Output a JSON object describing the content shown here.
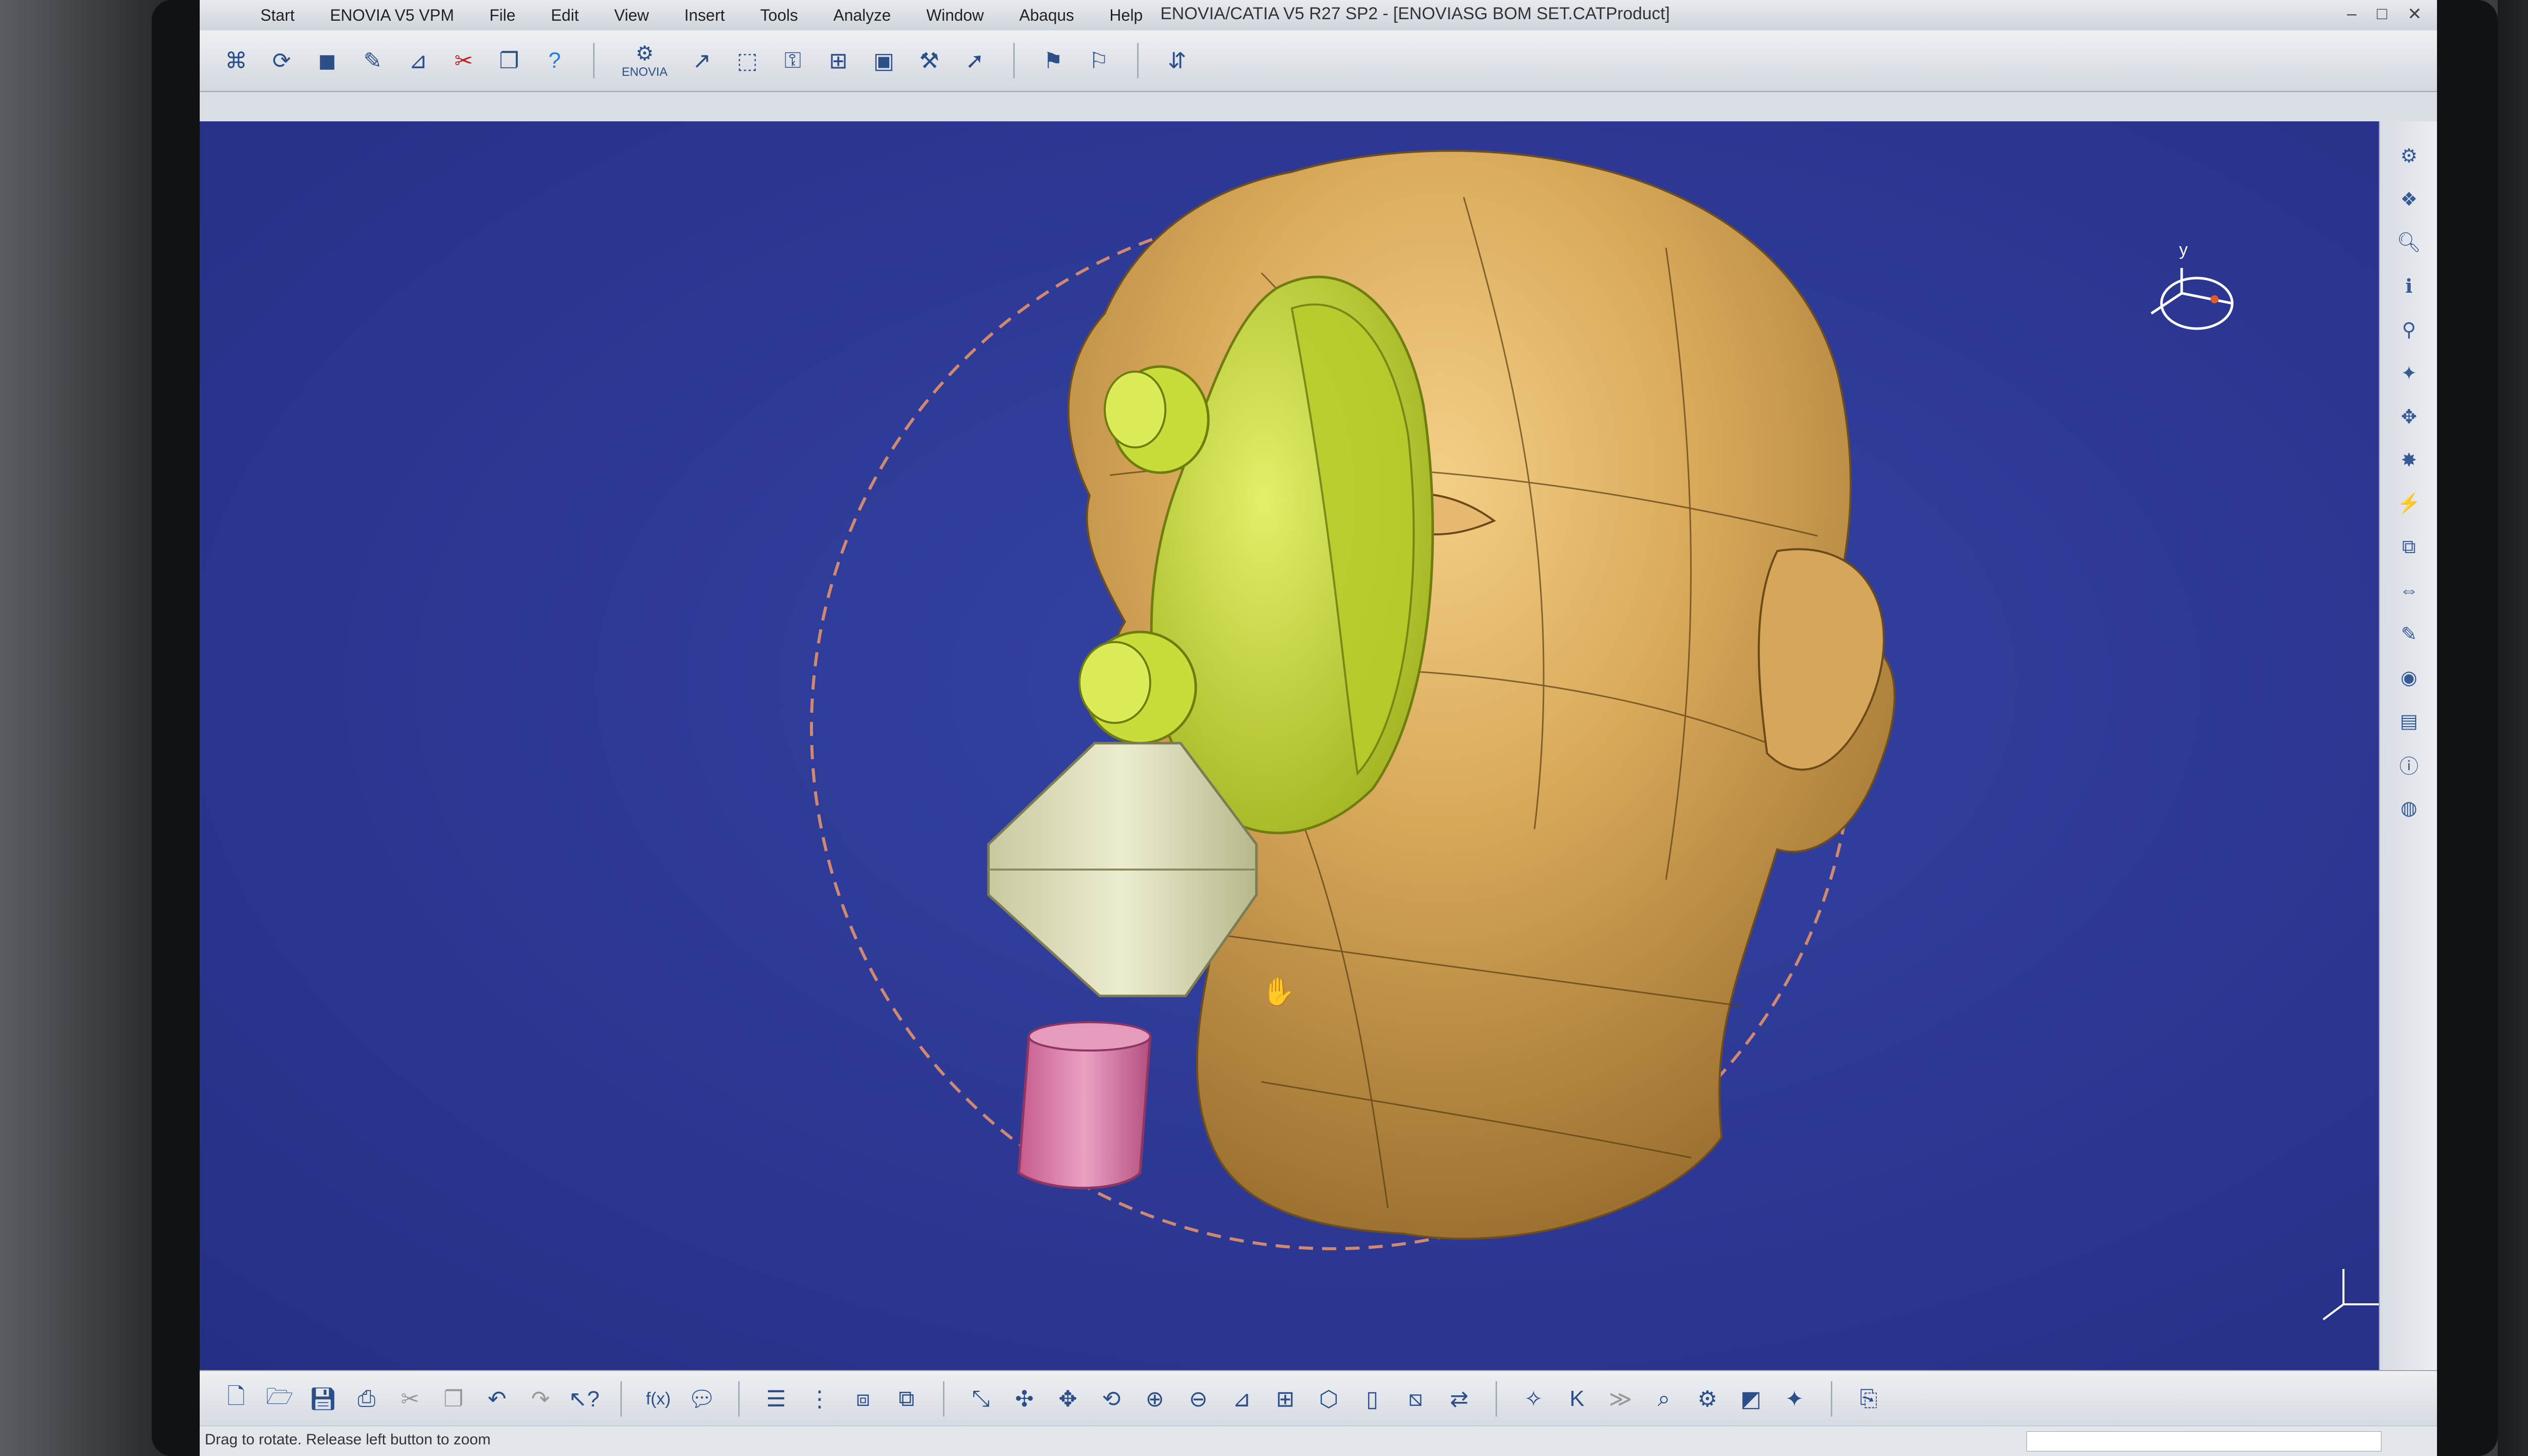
{
  "window": {
    "title": "ENOVIA/CATIA V5 R27 SP2 - [ENOVIASG BOM SET.CATProduct]"
  },
  "menu": {
    "items": [
      "Start",
      "ENOVIA V5 VPM",
      "File",
      "Edit",
      "View",
      "Insert",
      "Tools",
      "Analyze",
      "Window",
      "Abaqus",
      "Help"
    ]
  },
  "toolbar_top": {
    "icons": [
      "sketcher-icon",
      "rotate-icon",
      "cube-icon",
      "pencil-icon",
      "measure-icon",
      "scissors-icon",
      "copy-icon",
      "help-icon",
      "enovia-icon",
      "cursor-icon",
      "select-icon",
      "constraint-icon",
      "snap-icon",
      "save-icon",
      "workbench-icon",
      "arrow-icon",
      "flag-icon",
      "flag-icon",
      "swap-icon"
    ],
    "enovia_label": "ENOVIA"
  },
  "model": {
    "head_color": "#c99a4a",
    "mask_color": "#c6dd3a",
    "filter_color": "#dcdcb4",
    "connector_color": "#d97aa6",
    "background_color": "#2c3893",
    "compass_label": "y"
  },
  "toolbar_bottom": {
    "icons": [
      "new-icon",
      "open-icon",
      "save-icon",
      "print-icon",
      "cut-icon",
      "copy-icon",
      "undo-icon",
      "redo-icon",
      "whatsthis-icon",
      "formula-icon",
      "comment-icon",
      "list-icon",
      "tree-icon",
      "component-icon",
      "part-icon",
      "fit-all-icon",
      "pan-icon",
      "rotate-icon",
      "zoom-in-icon",
      "zoom-out-icon",
      "normal-view-icon",
      "iso-view-icon",
      "front-view-icon",
      "hide-icon",
      "swap-icon",
      "shading-icon",
      "snap-icon",
      "measure-icon",
      "walk-icon",
      "render-icon",
      "export-icon"
    ]
  },
  "status": {
    "message": "Drag to rotate. Release left button to zoom"
  }
}
